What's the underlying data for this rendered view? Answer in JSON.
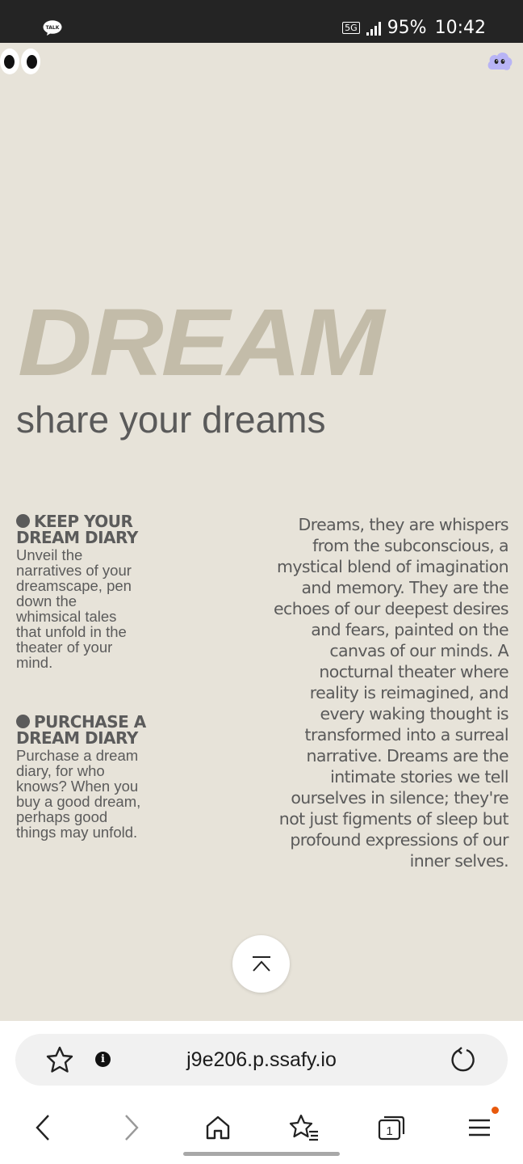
{
  "status_bar": {
    "app_icon": "talk-icon",
    "app_icon_text": "TALK",
    "network": "5G",
    "battery": "95%",
    "time": "10:42"
  },
  "hero": {
    "title": "DREAM",
    "subtitle": "share your dreams"
  },
  "features": [
    {
      "heading": "KEEP YOUR DREAM DIARY",
      "text": "Unveil the narratives of your dreamscape, pen down the whimsical tales that unfold in the theater of your mind."
    },
    {
      "heading": "PURCHASE A DREAM DIARY",
      "text": "Purchase a dream diary, for who knows? When you buy a good dream, perhaps good things may unfold."
    }
  ],
  "quote": "Dreams, they are whispers from the subconscious, a mystical blend of imagination and memory. They are the echoes of our deepest desires and fears, painted on the canvas of our minds. A nocturnal theater where reality is reimagined, and every waking thought is transformed into a surreal narrative. Dreams are the intimate stories we tell ourselves in silence; they're not just figments of sleep but profound expressions of our inner selves.",
  "browser": {
    "url": "j9e206.p.ssafy.io",
    "tab_count": "1"
  },
  "colors": {
    "background": "#e7e3d9",
    "hero_title": "#c3bca9",
    "text": "#5a5a5a",
    "cloud_accent": "#b8b4f5",
    "notification": "#e8590c"
  },
  "icons": {
    "scroll_top": "chevron-up-icon",
    "bookmark": "star-icon",
    "info": "info-icon",
    "reload": "reload-icon",
    "back": "back-arrow-icon",
    "forward": "forward-arrow-icon",
    "home": "home-icon",
    "bookmarks_list": "bookmarks-icon",
    "tabs": "tabs-icon",
    "menu": "menu-icon"
  }
}
